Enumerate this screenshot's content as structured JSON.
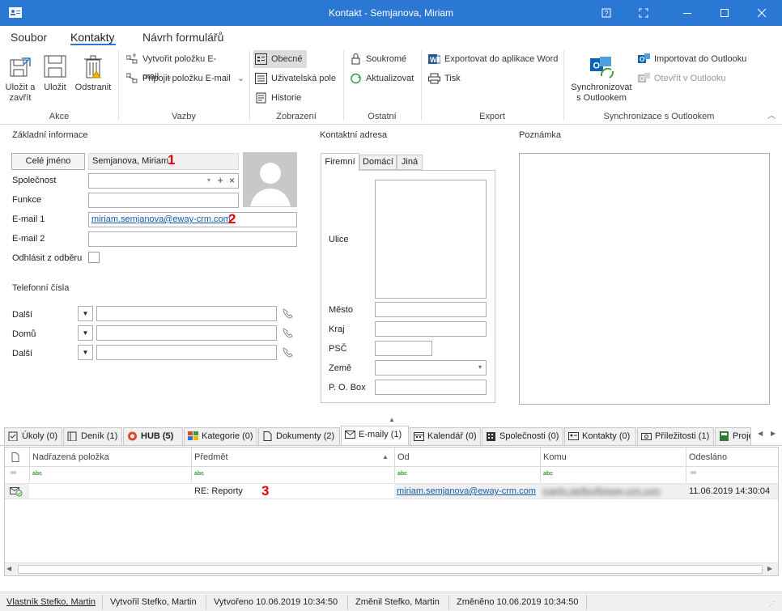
{
  "window": {
    "title": "Kontakt - Semjanova, Miriam",
    "icon": "contact-card-icon",
    "help_icon": "help-icon",
    "fullscreen_icon": "fullscreen-icon",
    "minimize": "minimize-icon",
    "maximize": "maximize-icon",
    "close": "close-icon"
  },
  "menu": {
    "items": [
      "Soubor",
      "Kontakty",
      "Návrh formulářů"
    ],
    "active": "Kontakty"
  },
  "ribbon": {
    "akce": {
      "label": "Akce",
      "save_close": [
        "Uložit a",
        "zavřít"
      ],
      "save": "Uložit",
      "delete": "Odstranit"
    },
    "vazby": {
      "label": "Vazby",
      "create_email": "Vytvořit položku E-mail",
      "attach_email": "Připojit položku E-mail"
    },
    "zobrazeni": {
      "label": "Zobrazení",
      "general": "Obecné",
      "user_fields": "Uživatelská pole",
      "history": "Historie"
    },
    "ostatni": {
      "label": "Ostatní",
      "private": "Soukromé",
      "update": "Aktualizovat"
    },
    "export": {
      "label": "Export",
      "word": "Exportovat do aplikace Word",
      "print": "Tisk"
    },
    "sync": {
      "label": "Synchronizace s Outlookem",
      "sync_btn": [
        "Synchronizovat",
        "s Outlookem"
      ],
      "import": "Importovat do Outlooku",
      "open": "Otevřít v Outlooku"
    }
  },
  "basic": {
    "section": "Základní informace",
    "full_name_btn": "Celé jméno",
    "full_name": "Semjanova, Miriam",
    "company_label": "Společnost",
    "function_label": "Funkce",
    "email1_label": "E-mail 1",
    "email1": "miriam.semjanova@eway-crm.com",
    "email2_label": "E-mail 2",
    "unsubscribe_label": "Odhlásit z odběru",
    "phones_section": "Telefonní čísla",
    "phones": [
      {
        "label": "Další"
      },
      {
        "label": "Domů"
      },
      {
        "label": "Další"
      }
    ]
  },
  "address": {
    "section": "Kontaktní adresa",
    "tabs": [
      "Firemní",
      "Domácí",
      "Jiná"
    ],
    "street": "Ulice",
    "city": "Město",
    "region": "Kraj",
    "zip": "PSČ",
    "country": "Země",
    "pobox": "P. O. Box"
  },
  "note": {
    "section": "Poznámka"
  },
  "annotations": [
    "1",
    "2",
    "3"
  ],
  "tabs": [
    {
      "label": "Úkoly (0)",
      "icon": "task-icon"
    },
    {
      "label": "Deník (1)",
      "icon": "journal-icon"
    },
    {
      "label": "HUB (5)",
      "icon": "hub-icon"
    },
    {
      "label": "Kategorie (0)",
      "icon": "category-icon"
    },
    {
      "label": "Dokumenty (2)",
      "icon": "document-icon"
    },
    {
      "label": "E-maily (1)",
      "icon": "email-icon"
    },
    {
      "label": "Kalendář (0)",
      "icon": "calendar-icon"
    },
    {
      "label": "Společnosti (0)",
      "icon": "company-icon"
    },
    {
      "label": "Kontakty (0)",
      "icon": "contact-icon"
    },
    {
      "label": "Příležitosti (1)",
      "icon": "opportunity-icon"
    },
    {
      "label": "Proje",
      "icon": "project-icon"
    }
  ],
  "grid": {
    "columns": [
      "Nadřazená položka",
      "Předmět",
      "Od",
      "Komu",
      "Odesláno"
    ],
    "filter_glyph": "abc",
    "rows": [
      {
        "parent": "",
        "subject": "RE: Reporty",
        "from": "miriam.semjanova@eway-crm.com",
        "to": "martin.stefko@eway-crm.com",
        "sent": "11.06.2019 14:30:04"
      }
    ]
  },
  "status": {
    "owner": "Vlastník Stefko, Martin",
    "created_by": "Vytvořil Stefko, Martin",
    "created": "Vytvořeno 10.06.2019 10:34:50",
    "changed_by": "Změnil Stefko, Martin",
    "changed": "Změněno 10.06.2019 10:34:50"
  }
}
